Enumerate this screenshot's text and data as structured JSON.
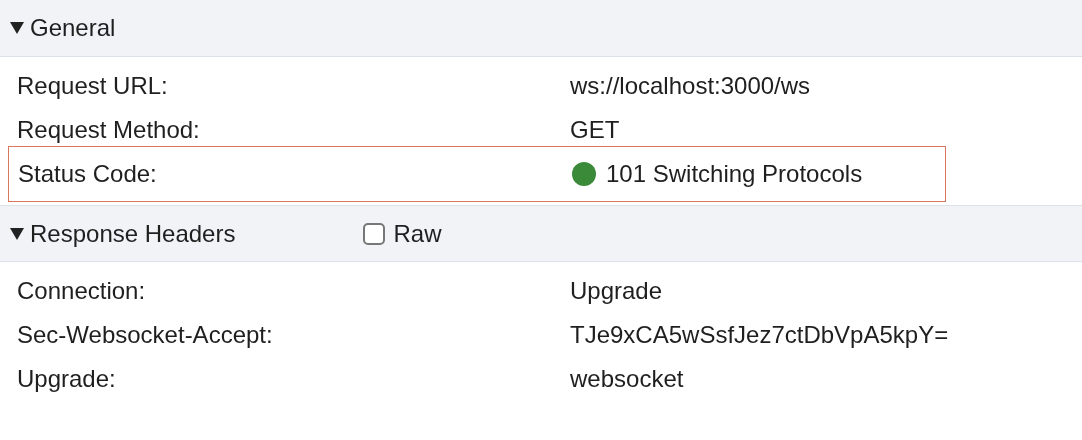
{
  "sections": [
    {
      "title": "General",
      "expanded": true,
      "rows": [
        {
          "label": "Request URL:",
          "value": "ws://localhost:3000/ws",
          "highlighted": false
        },
        {
          "label": "Request Method:",
          "value": "GET",
          "highlighted": false
        },
        {
          "label": "Status Code:",
          "value": "101 Switching Protocols",
          "highlighted": true,
          "color": "#3a8a3a"
        }
      ]
    },
    {
      "title": "Response Headers",
      "expanded": true,
      "raw": {
        "label": "Raw",
        "checked": false
      },
      "rows": [
        {
          "label": "Connection:",
          "value": "Upgrade",
          "highlighted": false
        },
        {
          "label": "Sec-Websocket-Accept:",
          "value": "TJe9xCA5wSsfJez7ctDbVpA5kpY=",
          "highlighted": false
        },
        {
          "label": "Upgrade:",
          "value": "websocket",
          "highlighted": false
        }
      ]
    }
  ]
}
